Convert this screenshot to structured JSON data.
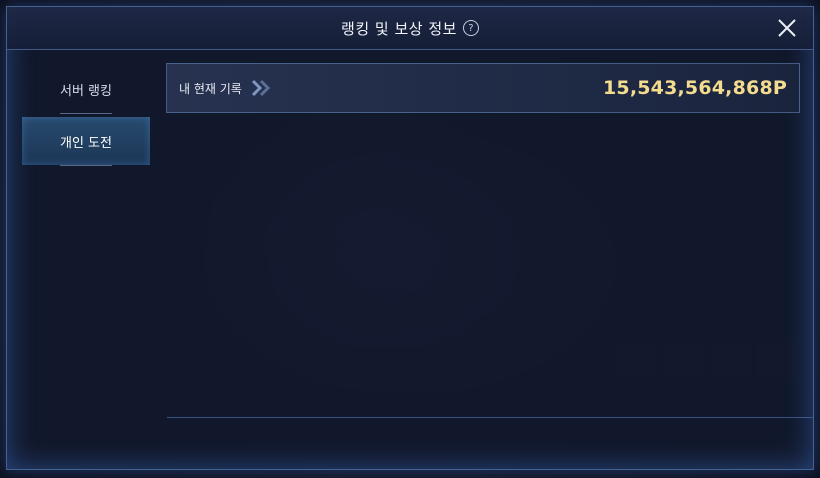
{
  "modal": {
    "title": "랭킹 및 보상 정보",
    "help_icon": "?",
    "close_icon": "close-icon"
  },
  "tabs": [
    {
      "label": "서버 랭킹",
      "active": false
    },
    {
      "label": "개인 도전",
      "active": true
    }
  ],
  "record": {
    "label": "내 현재 기록",
    "value": "15,543,564,868P"
  },
  "colors": {
    "accent_gold": "#f4dc8e",
    "active_tab": "#284a6e",
    "border_glow": "#6ea0eb"
  }
}
